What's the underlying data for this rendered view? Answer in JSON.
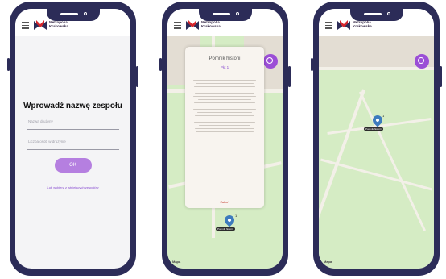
{
  "app": {
    "logo_text": "Metropolia\nKrakowska"
  },
  "screen1": {
    "title": "Wprowadź nazwę zespołu",
    "field1_placeholder": "Nazwa drużyny",
    "field2_placeholder": "Liczba osób w drużynie",
    "ok_label": "OK",
    "link_text": "Lub wybierz z istniejących zespołów"
  },
  "screen2": {
    "popup_title": "Pomnik historii",
    "popup_subtitle": "Pkt 1",
    "close_label": "Zakoń",
    "pin_label": "Pomnik historii",
    "pin_num": "1",
    "map_logo": "Mapa"
  },
  "screen3": {
    "pin_label": "Pomnik historii",
    "pin_num": "1",
    "map_logo": "Mapa"
  },
  "colors": {
    "phone": "#2c2c58",
    "accent": "#9b4ed6",
    "button": "#b57fe0",
    "map": "#d5ecc4"
  }
}
